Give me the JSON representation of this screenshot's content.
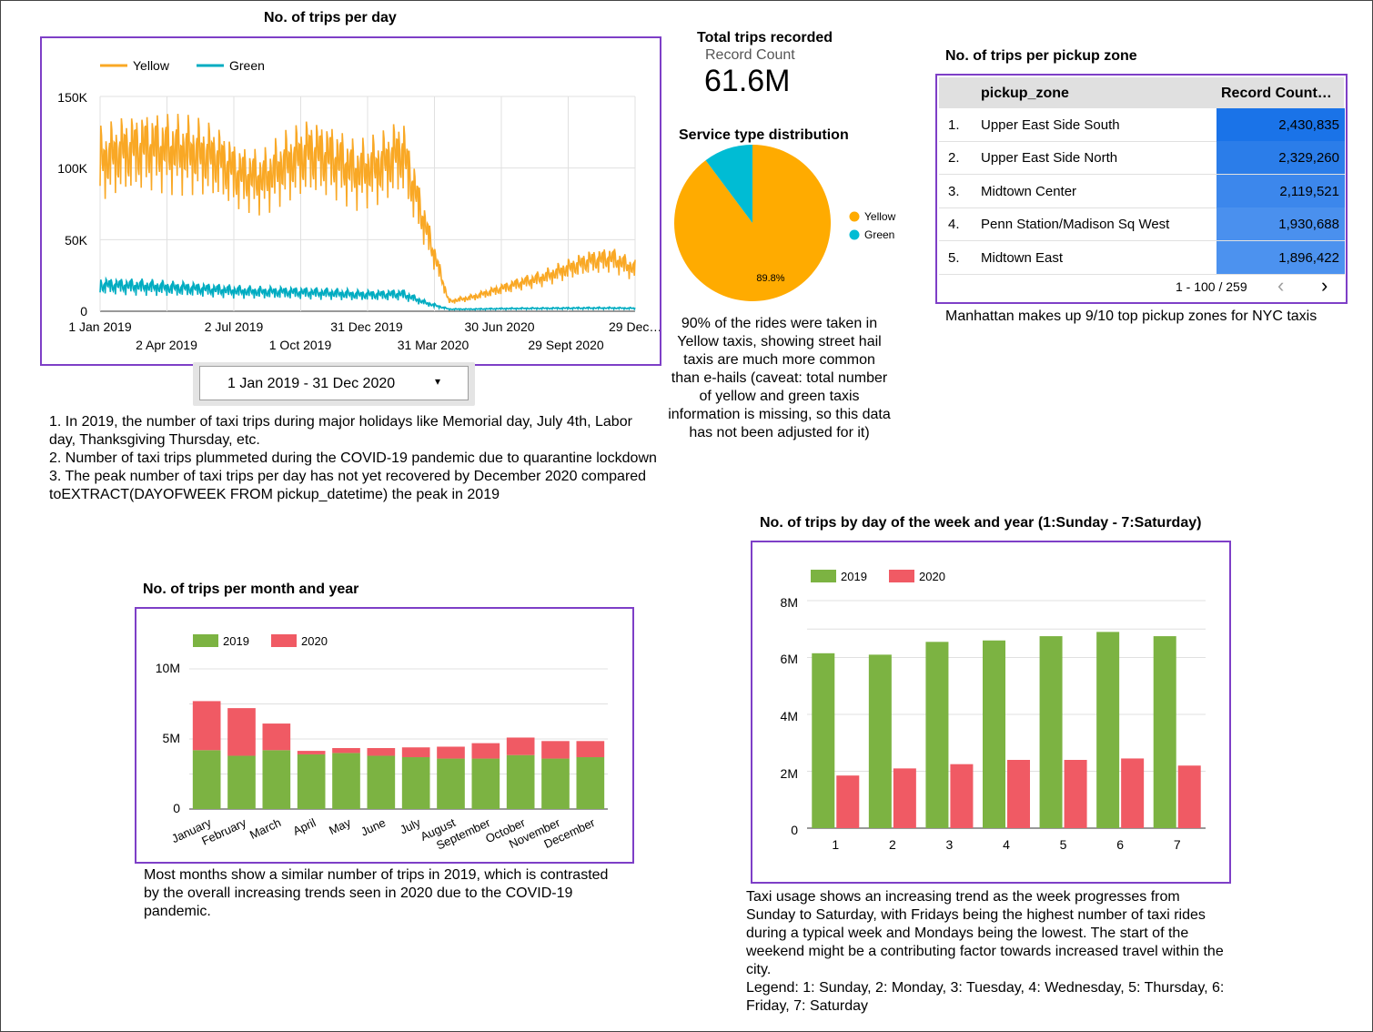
{
  "daily": {
    "title": "No. of trips per day",
    "legend": [
      "Yellow",
      "Green"
    ],
    "y_ticks": [
      "150K",
      "100K",
      "50K",
      "0"
    ],
    "x_ticks_top": [
      "1 Jan 2019",
      "2 Jul 2019",
      "31 Dec 2019",
      "30 Jun 2020",
      "29 Dec…"
    ],
    "x_ticks_bottom": [
      "2 Apr 2019",
      "1 Oct 2019",
      "31 Mar 2020",
      "29 Sept 2020"
    ],
    "date_range": "1 Jan 2019 - 31 Dec 2020",
    "notes": [
      "1. In 2019, the number of taxi trips during major holidays like Memorial day, July 4th, Labor day, Thanksgiving Thursday, etc.",
      "2. Number of taxi trips plummeted during the COVID-19 pandemic due to quarantine lockdown",
      "3. The peak number of taxi trips per day has not yet recovered by December 2020 compared toEXTRACT(DAYOFWEEK FROM pickup_datetime) the peak in 2019"
    ]
  },
  "scorecard": {
    "title": "Total trips recorded",
    "label": "Record Count",
    "value": "61.6M"
  },
  "pie": {
    "title": "Service type distribution",
    "slice_label": "89.8%",
    "legend": [
      "Yellow",
      "Green"
    ],
    "note": "90% of the rides were taken in Yellow taxis, showing street hail taxis are much more common than e-hails (caveat: total number of yellow and green taxis information is missing, so this data has not been adjusted for it)"
  },
  "zones": {
    "title": "No. of trips per pickup zone",
    "col_zone": "pickup_zone",
    "col_count": "Record Count…",
    "rows": [
      {
        "rank": "1.",
        "zone": "Upper East Side South",
        "count": "2,430,835"
      },
      {
        "rank": "2.",
        "zone": "Upper East Side North",
        "count": "2,329,260"
      },
      {
        "rank": "3.",
        "zone": "Midtown Center",
        "count": "2,119,521"
      },
      {
        "rank": "4.",
        "zone": "Penn Station/Madison Sq West",
        "count": "1,930,688"
      },
      {
        "rank": "5.",
        "zone": "Midtown East",
        "count": "1,896,422"
      }
    ],
    "pagination": "1 - 100 / 259",
    "note": "Manhattan makes up 9/10 top pickup zones for NYC taxis"
  },
  "monthly": {
    "title": "No. of trips per month and year",
    "legend": [
      "2019",
      "2020"
    ],
    "y_ticks": [
      "10M",
      "5M",
      "0"
    ],
    "note": "Most months show a similar number of trips in 2019, which is contrasted by the overall increasing trends seen in 2020 due to the COVID-19 pandemic."
  },
  "weekly": {
    "title": "No. of trips by day of the week and year (1:Sunday - 7:Saturday)",
    "legend": [
      "2019",
      "2020"
    ],
    "y_ticks": [
      "8M",
      "6M",
      "4M",
      "2M",
      "0"
    ],
    "note1": "Taxi usage shows an increasing trend as the week progresses from Sunday to Saturday, with Fridays being the highest number of taxi rides during a typical week and Mondays being the lowest. The start of the weekend might be a contributing factor towards increased travel within the city.",
    "note2": "Legend: 1: Sunday, 2: Monday, 3: Tuesday, 4: Wednesday, 5: Thursday, 6: Friday, 7: Saturday"
  },
  "colors": {
    "yellow": "#f9a825",
    "green_taxi": "#00acc1",
    "y2019": "#7cb342",
    "y2020": "#f05a64",
    "border": "#7e3fc7",
    "heat_dark": "#1a73e8",
    "pie_yellow": "#ffab00",
    "pie_green": "#00bcd4"
  },
  "chart_data": [
    {
      "type": "line",
      "title": "No. of trips per day",
      "ylim": [
        0,
        150000
      ],
      "x_range": [
        "2019-01-01",
        "2020-12-31"
      ],
      "series": [
        {
          "name": "Yellow",
          "x": [
            "2019-01",
            "2019-02",
            "2019-03",
            "2019-04",
            "2019-05",
            "2019-06",
            "2019-07",
            "2019-08",
            "2019-09",
            "2019-10",
            "2019-11",
            "2019-12",
            "2020-01",
            "2020-02",
            "2020-03",
            "2020-04",
            "2020-05",
            "2020-06",
            "2020-07",
            "2020-08",
            "2020-09",
            "2020-10",
            "2020-11",
            "2020-12"
          ],
          "values": [
            108000,
            115000,
            118000,
            116000,
            114000,
            110000,
            98000,
            95000,
            106000,
            114000,
            110000,
            100000,
            104000,
            115000,
            60000,
            7000,
            10000,
            15000,
            20000,
            24000,
            30000,
            36000,
            38000,
            30000
          ]
        },
        {
          "name": "Green",
          "x": [
            "2019-01",
            "2019-02",
            "2019-03",
            "2019-04",
            "2019-05",
            "2019-06",
            "2019-07",
            "2019-08",
            "2019-09",
            "2019-10",
            "2019-11",
            "2019-12",
            "2020-01",
            "2020-02",
            "2020-03",
            "2020-04",
            "2020-05",
            "2020-06",
            "2020-07",
            "2020-08",
            "2020-09",
            "2020-10",
            "2020-11",
            "2020-12"
          ],
          "values": [
            19000,
            18500,
            18000,
            17000,
            16500,
            15500,
            14500,
            14000,
            14000,
            13500,
            13000,
            12000,
            12000,
            12500,
            6000,
            1500,
            1500,
            1800,
            2000,
            2100,
            2200,
            2300,
            2300,
            2100
          ]
        }
      ]
    },
    {
      "type": "pie",
      "title": "Service type distribution",
      "categories": [
        "Yellow",
        "Green"
      ],
      "values": [
        89.8,
        10.2
      ]
    },
    {
      "type": "bar",
      "title": "No. of trips per month and year",
      "stacked": true,
      "categories": [
        "January",
        "February",
        "March",
        "April",
        "May",
        "June",
        "July",
        "August",
        "September",
        "October",
        "November",
        "December"
      ],
      "ylim": [
        0,
        12000000
      ],
      "series": [
        {
          "name": "2019",
          "values": [
            4200000,
            3800000,
            4200000,
            3900000,
            4000000,
            3800000,
            3700000,
            3600000,
            3600000,
            3850000,
            3600000,
            3700000
          ]
        },
        {
          "name": "2020",
          "values": [
            3500000,
            3400000,
            1900000,
            250000,
            350000,
            550000,
            700000,
            850000,
            1100000,
            1250000,
            1250000,
            1150000
          ]
        }
      ]
    },
    {
      "type": "bar",
      "title": "No. of trips by day of the week and year (1:Sunday - 7:Saturday)",
      "categories": [
        "1",
        "2",
        "3",
        "4",
        "5",
        "6",
        "7"
      ],
      "ylim": [
        0,
        8000000
      ],
      "series": [
        {
          "name": "2019",
          "values": [
            6150000,
            6100000,
            6550000,
            6600000,
            6750000,
            6900000,
            6750000
          ]
        },
        {
          "name": "2020",
          "values": [
            1850000,
            2100000,
            2250000,
            2400000,
            2400000,
            2450000,
            2200000
          ]
        }
      ]
    }
  ]
}
